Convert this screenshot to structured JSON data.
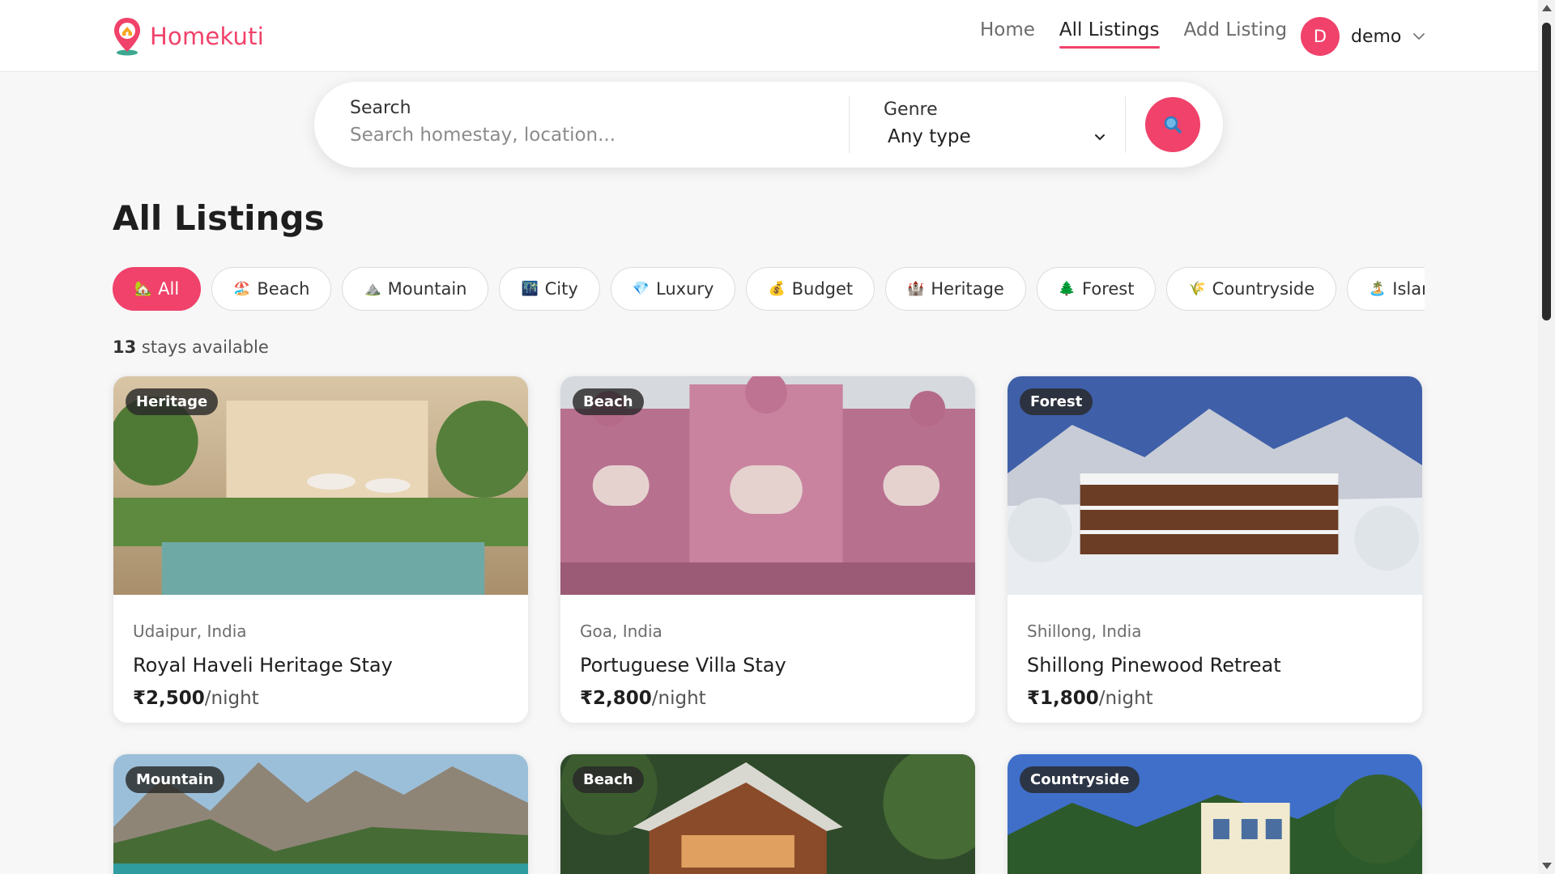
{
  "brand": {
    "name": "Homekuti",
    "accent": "#f0426a"
  },
  "nav": [
    {
      "label": "Home",
      "active": false
    },
    {
      "label": "All Listings",
      "active": true
    },
    {
      "label": "Add Listing",
      "active": false
    }
  ],
  "user": {
    "initial": "D",
    "name": "demo"
  },
  "search": {
    "label": "Search",
    "placeholder": "Search homestay, location...",
    "genre_label": "Genre",
    "genre_value": "Any type"
  },
  "page_title": "All Listings",
  "categories": [
    {
      "icon": "🏡",
      "label": "All"
    },
    {
      "icon": "🏖️",
      "label": "Beach"
    },
    {
      "icon": "⛰️",
      "label": "Mountain"
    },
    {
      "icon": "🌃",
      "label": "City"
    },
    {
      "icon": "💎",
      "label": "Luxury"
    },
    {
      "icon": "💰",
      "label": "Budget"
    },
    {
      "icon": "🏰",
      "label": "Heritage"
    },
    {
      "icon": "🌲",
      "label": "Forest"
    },
    {
      "icon": "🌾",
      "label": "Countryside"
    },
    {
      "icon": "🏝️",
      "label": "Island"
    }
  ],
  "count": {
    "number": "13",
    "text": " stays available"
  },
  "listings": [
    {
      "badge": "Heritage",
      "location": "Udaipur, India",
      "name": "Royal Haveli Heritage Stay",
      "price": "₹2,500",
      "per": "/night"
    },
    {
      "badge": "Beach",
      "location": "Goa, India",
      "name": "Portuguese Villa Stay",
      "price": "₹2,800",
      "per": "/night"
    },
    {
      "badge": "Forest",
      "location": "Shillong, India",
      "name": "Shillong Pinewood Retreat",
      "price": "₹1,800",
      "per": "/night"
    },
    {
      "badge": "Mountain"
    },
    {
      "badge": "Beach"
    },
    {
      "badge": "Countryside"
    }
  ]
}
